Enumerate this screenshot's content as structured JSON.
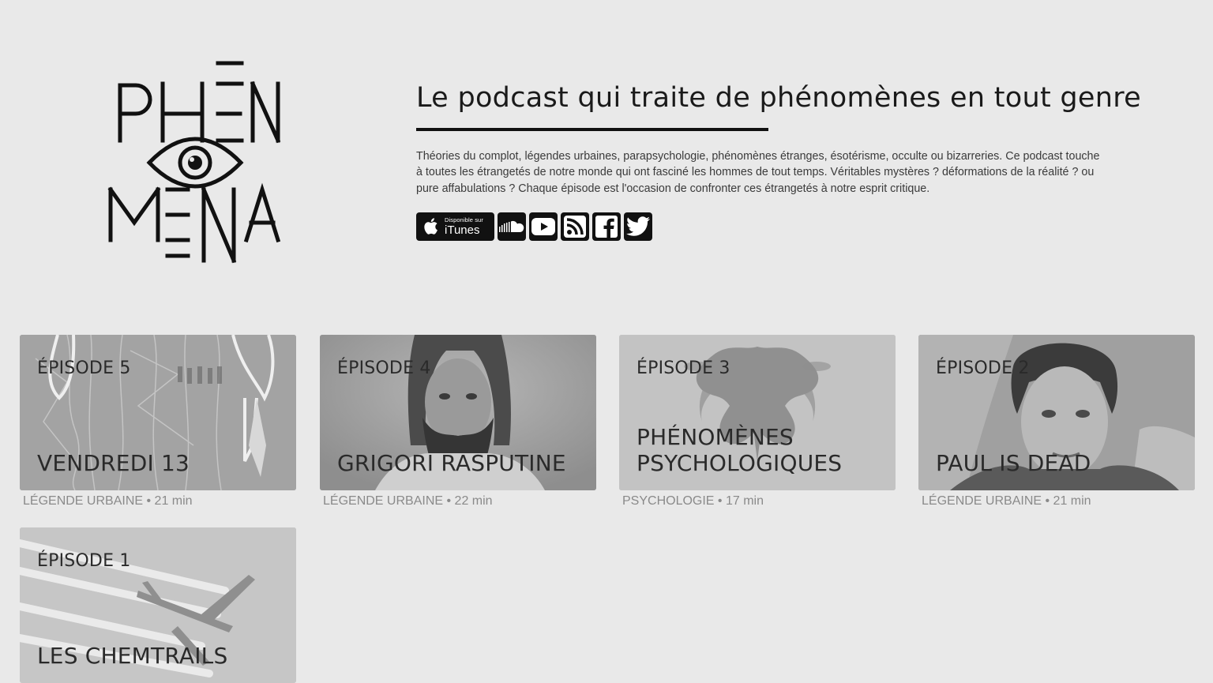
{
  "logo": {
    "line1": "PHĒN",
    "line2": "MENA"
  },
  "header": {
    "tagline": "Le podcast qui traite de phénomènes en tout genre",
    "description": "Théories du complot, légendes urbaines, parapsychologie, phénomènes étranges, ésotérisme, occulte ou bizarreries. Ce podcast touche à toutes les étrangetés de notre monde qui ont fasciné les hommes de tout temps. Véritables mystères ? déformations de la réalité ? ou pure affabulations ? Chaque épisode est l'occasion de confronter ces étrangetés à notre esprit critique."
  },
  "social": {
    "itunes_small": "Disponible sur",
    "itunes_big": "iTunes",
    "icons": [
      "apple-icon",
      "soundcloud-icon",
      "youtube-icon",
      "rss-icon",
      "facebook-icon",
      "twitter-icon"
    ]
  },
  "episodes": [
    {
      "number": "ÉPISODE 5",
      "title": "VENDREDI 13",
      "category": "LÉGENDE URBAINE",
      "duration": "21 min"
    },
    {
      "number": "ÉPISODE 4",
      "title": "GRIGORI RASPUTINE",
      "category": "LÉGENDE URBAINE",
      "duration": "22 min"
    },
    {
      "number": "ÉPISODE 3",
      "title": "PHÉNOMÈNES PSYCHOLOGIQUES",
      "category": "PSYCHOLOGIE",
      "duration": "17 min"
    },
    {
      "number": "ÉPISODE 2",
      "title": "PAUL IS DEAD",
      "category": "LÉGENDE URBAINE",
      "duration": "21 min"
    },
    {
      "number": "ÉPISODE 1",
      "title": "LES CHEMTRAILS",
      "category": "",
      "duration": ""
    }
  ],
  "meta_separator": " • "
}
